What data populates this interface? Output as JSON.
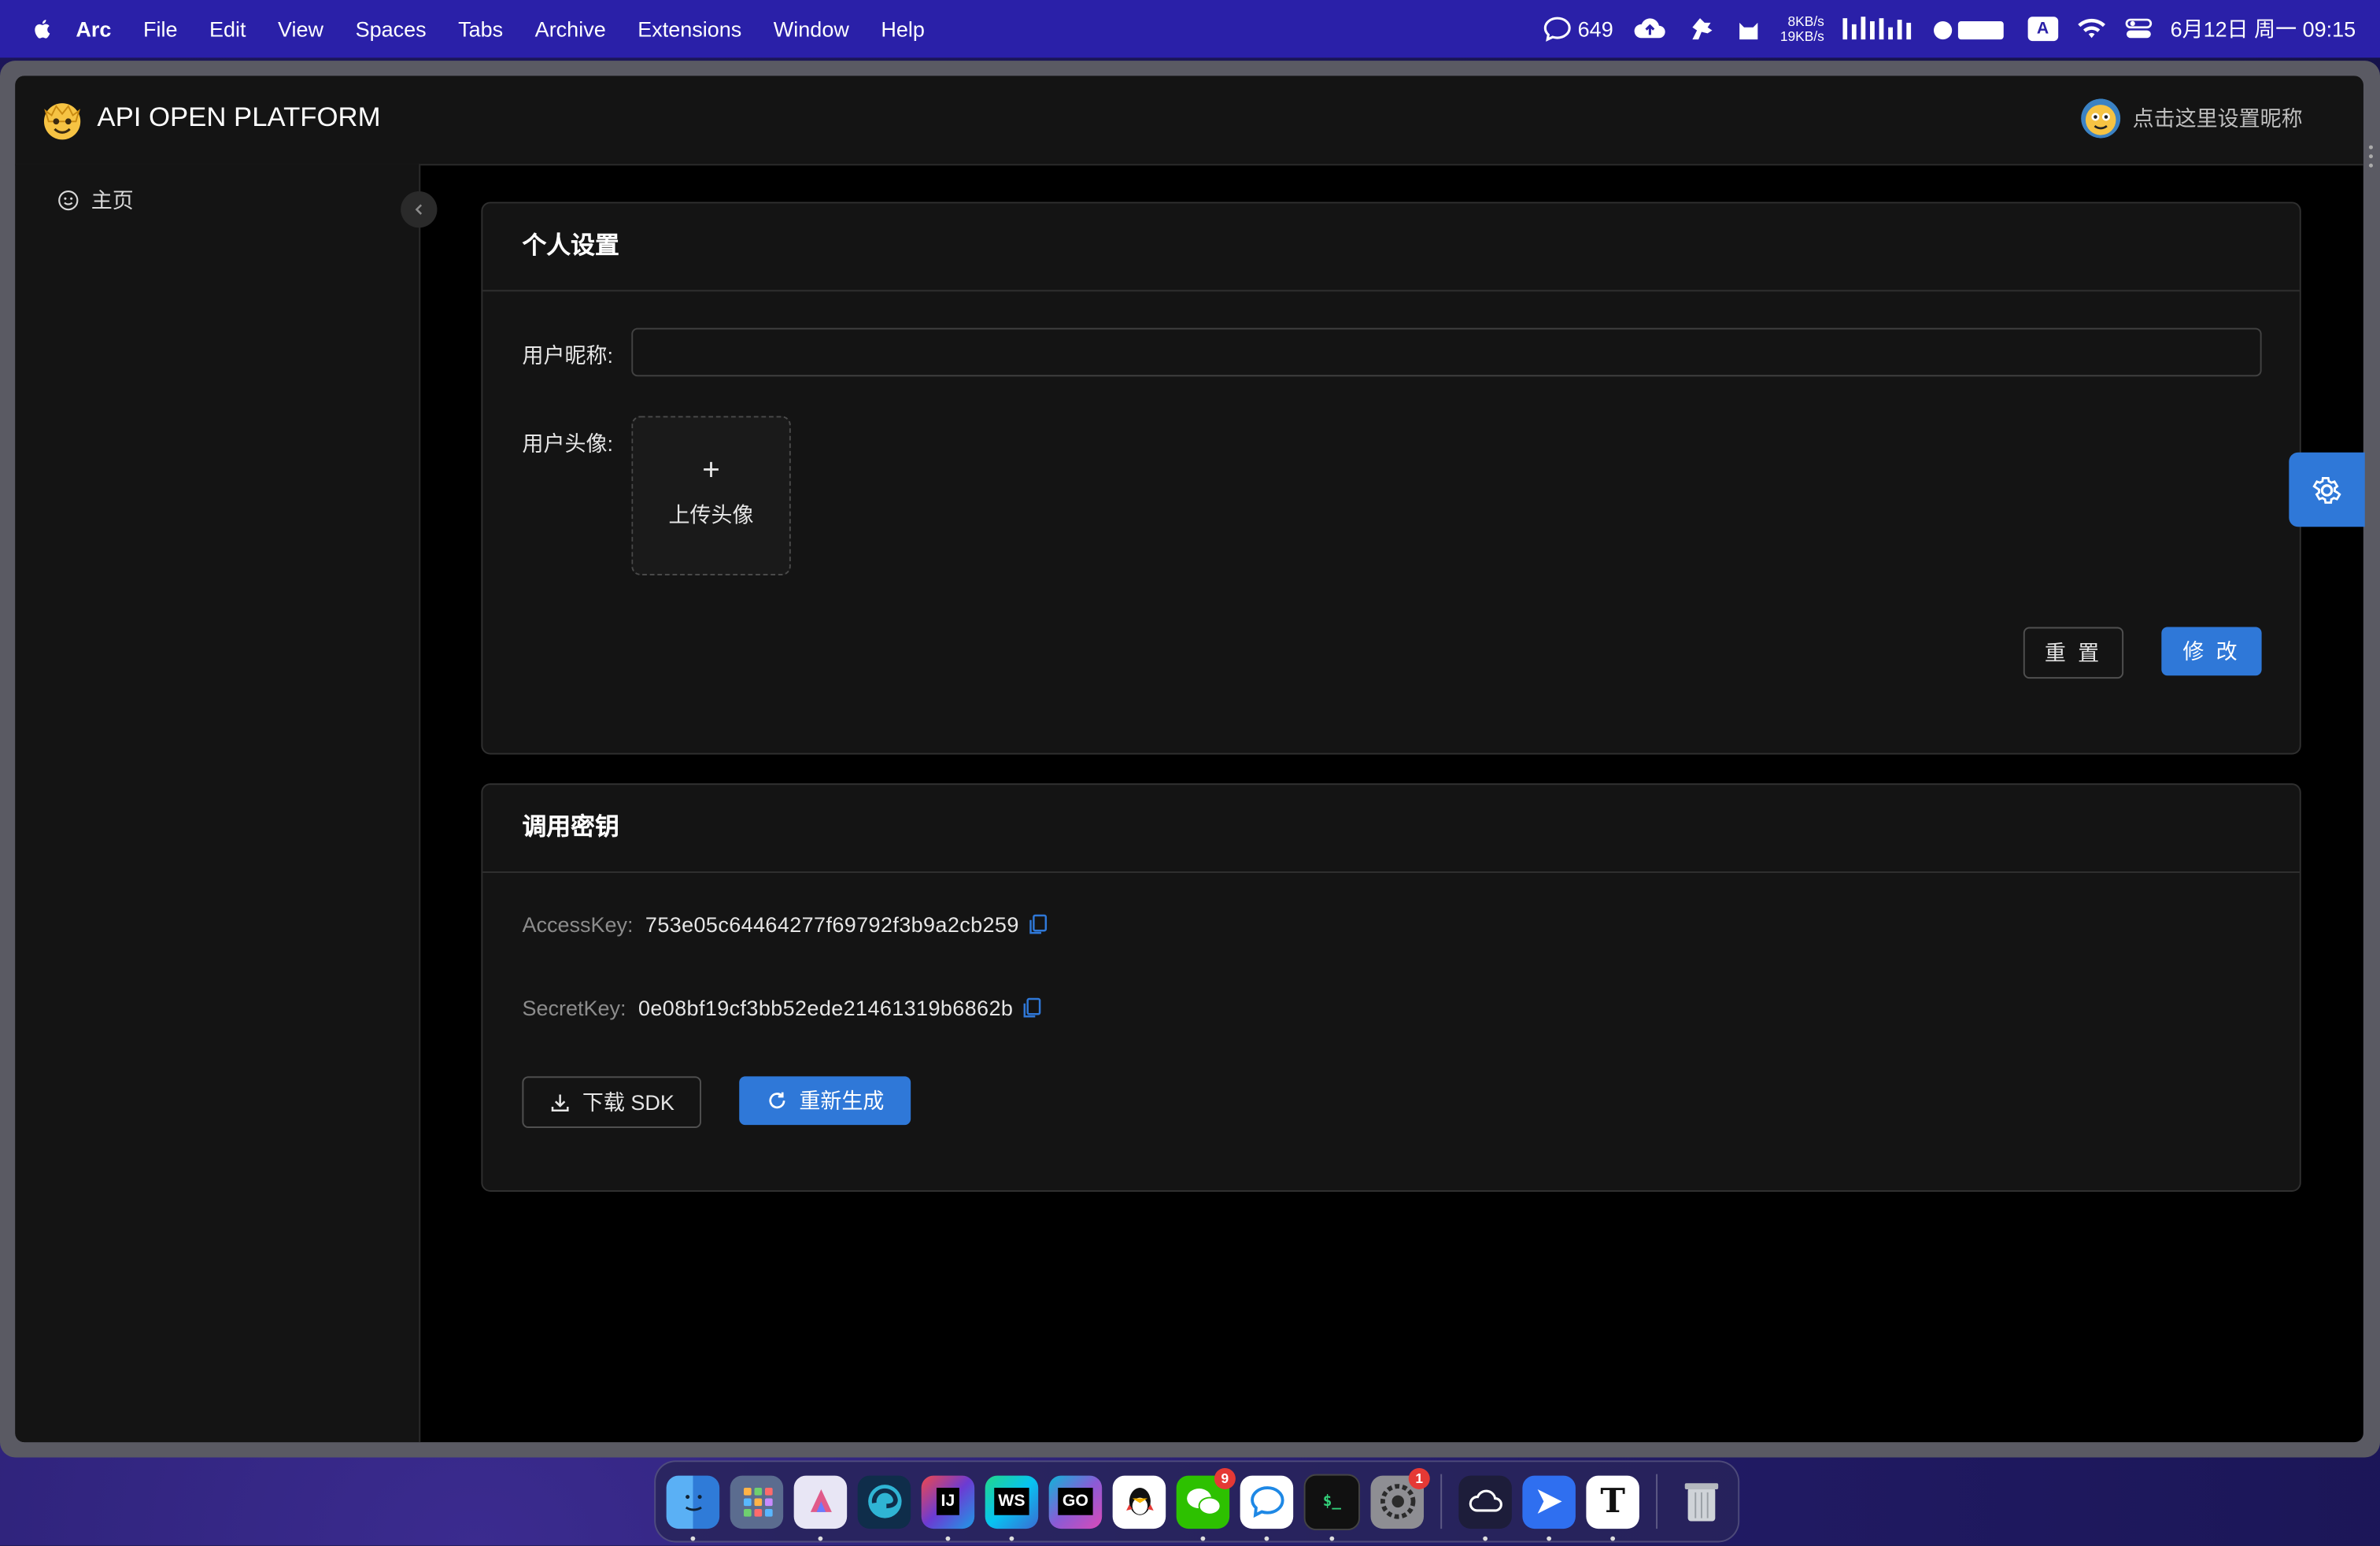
{
  "menubar": {
    "app_name": "Arc",
    "menus": [
      "File",
      "Edit",
      "View",
      "Spaces",
      "Tabs",
      "Archive",
      "Extensions",
      "Window",
      "Help"
    ],
    "chat_count": "649",
    "net_up": "8KB/s",
    "net_down": "19KB/s",
    "ime": "A",
    "datetime": "6月12日 周一  09:15"
  },
  "header": {
    "brand": "API OPEN PLATFORM",
    "user_prompt": "点击这里设置昵称"
  },
  "sidebar": {
    "home_label": "主页"
  },
  "profile": {
    "title": "个人设置",
    "nickname_label": "用户昵称:",
    "nickname_value": "",
    "avatar_label": "用户头像:",
    "upload_plus": "+",
    "upload_label": "上传头像",
    "reset_label": "重 置",
    "modify_label": "修 改"
  },
  "keys": {
    "title": "调用密钥",
    "access_key_label": "AccessKey:",
    "access_key_value": "753e05c64464277f69792f3b9a2cb259",
    "secret_key_label": "SecretKey:",
    "secret_key_value": "0e08bf19cf3bb52ede21461319b6862b",
    "download_sdk_label": "下载 SDK",
    "regenerate_label": "重新生成"
  },
  "dock": {
    "items": [
      {
        "name": "finder",
        "label": ""
      },
      {
        "name": "launchpad",
        "label": ""
      },
      {
        "name": "copilot",
        "label": ""
      },
      {
        "name": "edge-dev",
        "label": ""
      },
      {
        "name": "intellij",
        "label": "IJ"
      },
      {
        "name": "webstorm",
        "label": "WS"
      },
      {
        "name": "goland",
        "label": "GO"
      },
      {
        "name": "qq",
        "label": ""
      },
      {
        "name": "wechat",
        "label": "",
        "badge": "9"
      },
      {
        "name": "messages",
        "label": ""
      },
      {
        "name": "terminal",
        "label": "$_"
      },
      {
        "name": "system-settings",
        "label": "",
        "badge": "1"
      },
      {
        "name": "cloud-app",
        "label": ""
      },
      {
        "name": "feishu",
        "label": ""
      },
      {
        "name": "typora",
        "label": "T"
      },
      {
        "name": "trash",
        "label": ""
      }
    ]
  },
  "colors": {
    "accent": "#2f78d8",
    "menubar": "#2a20a8",
    "panel": "#141414"
  }
}
